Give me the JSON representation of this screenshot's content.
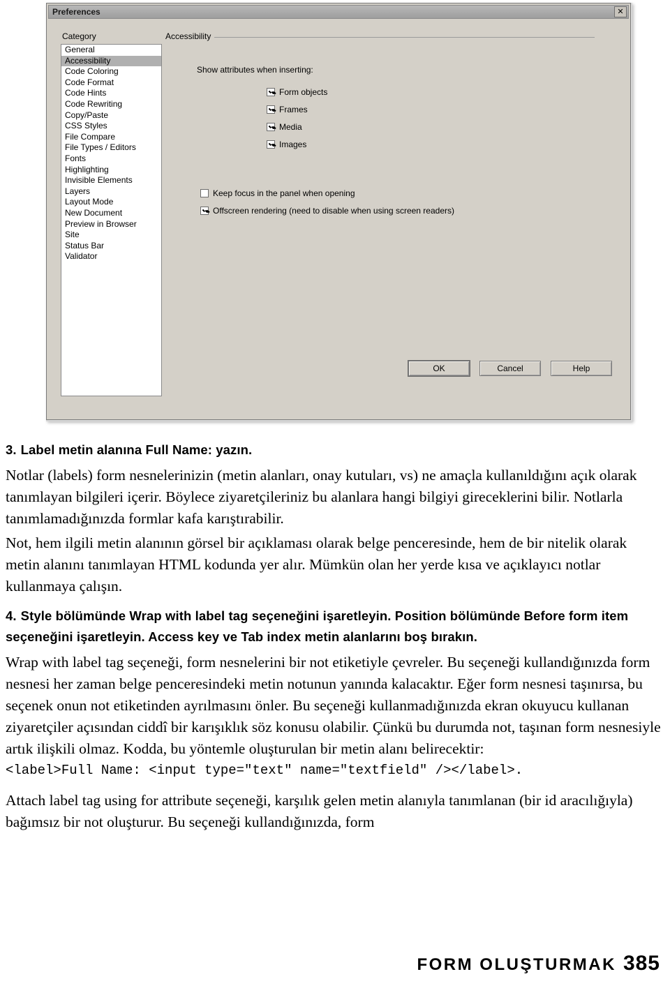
{
  "dialog": {
    "title": "Preferences",
    "close_icon": "close-icon",
    "category_label": "Category",
    "panel_label": "Accessibility",
    "categories": [
      "General",
      "Accessibility",
      "Code Coloring",
      "Code Format",
      "Code Hints",
      "Code Rewriting",
      "Copy/Paste",
      "CSS Styles",
      "File Compare",
      "File Types / Editors",
      "Fonts",
      "Highlighting",
      "Invisible Elements",
      "Layers",
      "Layout Mode",
      "New Document",
      "Preview in Browser",
      "Site",
      "Status Bar",
      "Validator"
    ],
    "selected_category": "Accessibility",
    "panel": {
      "group_label": "Show attributes when inserting:",
      "checkboxes": [
        {
          "label": "Form objects",
          "checked": true
        },
        {
          "label": "Frames",
          "checked": true
        },
        {
          "label": "Media",
          "checked": true
        },
        {
          "label": "Images",
          "checked": true
        }
      ],
      "options": [
        {
          "label": "Keep focus in the panel when opening",
          "checked": false
        },
        {
          "label": "Offscreen rendering (need to disable when using screen readers)",
          "checked": true
        }
      ]
    },
    "buttons": {
      "ok": "OK",
      "cancel": "Cancel",
      "help": "Help"
    }
  },
  "content": {
    "step3_heading": "3. Label metin alanına Full Name: yazın.",
    "step3_num": "3.",
    "step3_text": "Label metin alanına Full Name: yazın.",
    "para1": "Notlar (labels) form nesnelerinizin (metin alanları, onay kutuları, vs) ne amaçla kullanıldığını açık olarak tanımlayan bilgileri içerir. Böylece ziyaretçileriniz bu alanlara hangi bilgiyi gireceklerini bilir. Notlarla tanımlamadığınızda formlar kafa karıştırabilir.",
    "para2": "Not, hem ilgili metin alanının görsel bir açıklaması olarak belge penceresinde, hem de bir nitelik olarak metin alanını tanımlayan HTML kodunda yer alır. Mümkün olan her yerde kısa ve açıklayıcı notlar kullanmaya çalışın.",
    "step4_num": "4.",
    "step4_text": "Style bölümünde Wrap with label tag seçeneğini işaretleyin. Position bölümünde Before form item seçeneğini işaretleyin. Access key ve Tab index metin alanlarını boş bırakın.",
    "para3": "Wrap with label tag seçeneği, form nesnelerini bir not etiketiyle çevreler. Bu seçeneği kullandığınızda form nesnesi her zaman belge penceresindeki metin notunun yanında kalacaktır. Eğer form nesnesi taşınırsa, bu seçenek onun not etiketinden ayrılmasını önler. Bu seçeneği kullanmadığınızda ekran okuyucu kullanan ziyaretçiler açısından ciddî bir karışıklık söz konusu olabilir. Çünkü bu durumda not, taşınan form nesnesiyle artık ilişkili olmaz. Kodda, bu yöntemle oluşturulan bir metin alanı belirecektir:",
    "code_line": "<label>Full Name: <input type=\"text\" name=\"textfield\" /></label>.",
    "para4": "Attach label tag using for attribute seçeneği, karşılık gelen metin alanıyla tanımlanan (bir id aracılığıyla) bağımsız bir not oluşturur. Bu seçeneği kullandığınızda, form"
  },
  "footer": {
    "text": "FORM OLUŞTURMAK",
    "page": "385"
  }
}
